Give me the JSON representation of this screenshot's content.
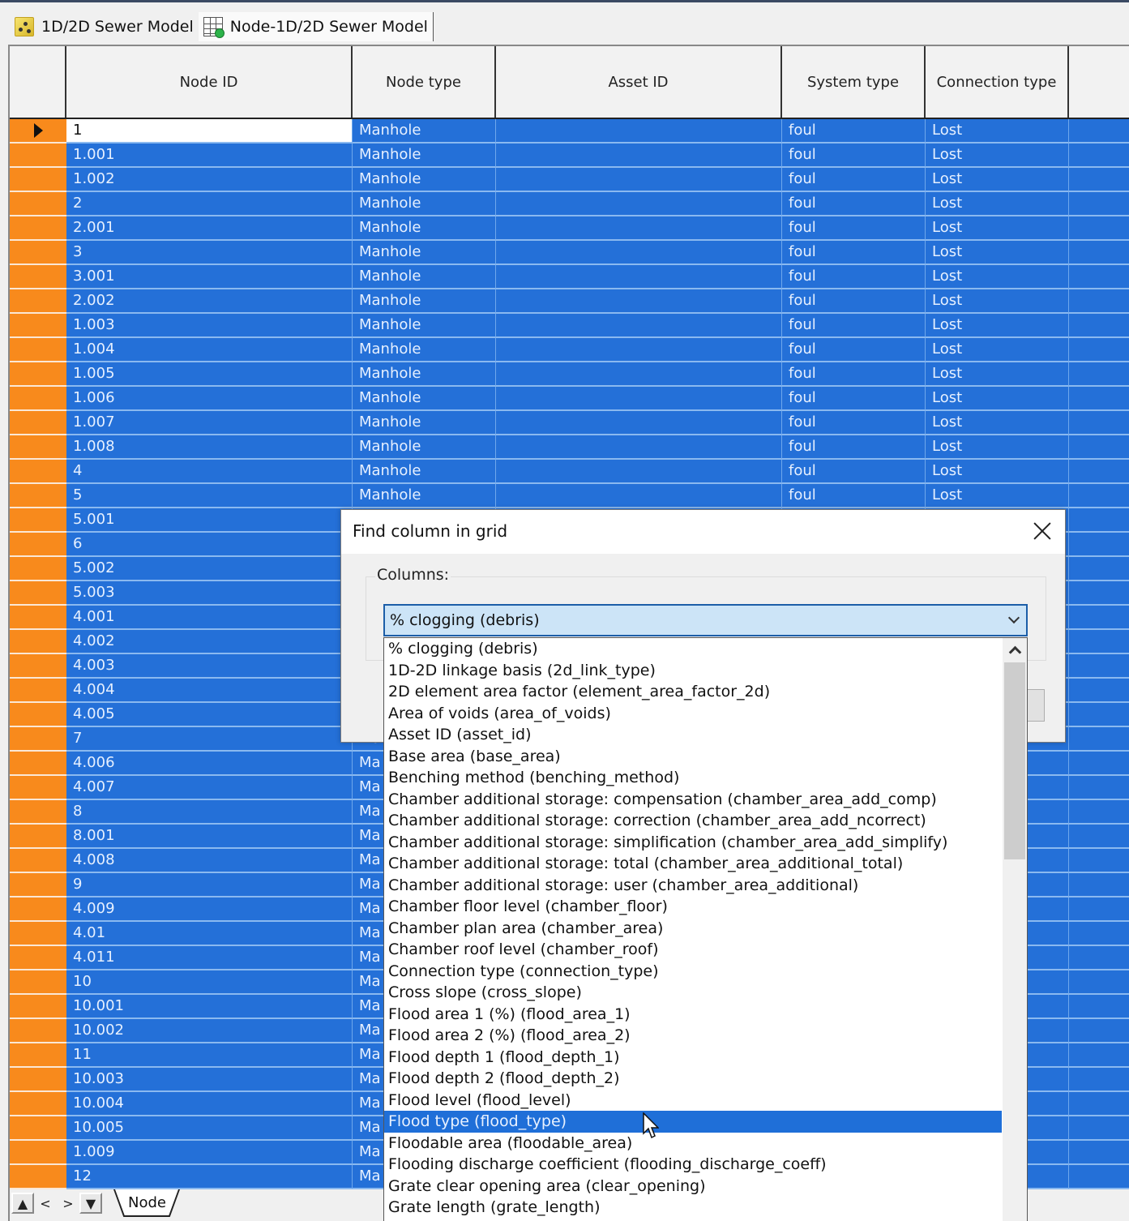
{
  "tabs": [
    {
      "label": "1D/2D Sewer Model",
      "icon": "network-model-icon",
      "active": false
    },
    {
      "label": "Node-1D/2D Sewer Model",
      "icon": "grid-table-icon",
      "active": true
    }
  ],
  "grid": {
    "columns": [
      "",
      "Node ID",
      "Node type",
      "Asset ID",
      "System type",
      "Connection type",
      ""
    ],
    "current_row_index": 0,
    "rows": [
      {
        "id": "1",
        "type": "Manhole",
        "asset": "",
        "system": "foul",
        "conn": "Lost"
      },
      {
        "id": "1.001",
        "type": "Manhole",
        "asset": "",
        "system": "foul",
        "conn": "Lost"
      },
      {
        "id": "1.002",
        "type": "Manhole",
        "asset": "",
        "system": "foul",
        "conn": "Lost"
      },
      {
        "id": "2",
        "type": "Manhole",
        "asset": "",
        "system": "foul",
        "conn": "Lost"
      },
      {
        "id": "2.001",
        "type": "Manhole",
        "asset": "",
        "system": "foul",
        "conn": "Lost"
      },
      {
        "id": "3",
        "type": "Manhole",
        "asset": "",
        "system": "foul",
        "conn": "Lost"
      },
      {
        "id": "3.001",
        "type": "Manhole",
        "asset": "",
        "system": "foul",
        "conn": "Lost"
      },
      {
        "id": "2.002",
        "type": "Manhole",
        "asset": "",
        "system": "foul",
        "conn": "Lost"
      },
      {
        "id": "1.003",
        "type": "Manhole",
        "asset": "",
        "system": "foul",
        "conn": "Lost"
      },
      {
        "id": "1.004",
        "type": "Manhole",
        "asset": "",
        "system": "foul",
        "conn": "Lost"
      },
      {
        "id": "1.005",
        "type": "Manhole",
        "asset": "",
        "system": "foul",
        "conn": "Lost"
      },
      {
        "id": "1.006",
        "type": "Manhole",
        "asset": "",
        "system": "foul",
        "conn": "Lost"
      },
      {
        "id": "1.007",
        "type": "Manhole",
        "asset": "",
        "system": "foul",
        "conn": "Lost"
      },
      {
        "id": "1.008",
        "type": "Manhole",
        "asset": "",
        "system": "foul",
        "conn": "Lost"
      },
      {
        "id": "4",
        "type": "Manhole",
        "asset": "",
        "system": "foul",
        "conn": "Lost"
      },
      {
        "id": "5",
        "type": "Manhole",
        "asset": "",
        "system": "foul",
        "conn": "Lost"
      },
      {
        "id": "5.001",
        "type": "",
        "asset": "",
        "system": "",
        "conn": ""
      },
      {
        "id": "6",
        "type": "",
        "asset": "",
        "system": "",
        "conn": ""
      },
      {
        "id": "5.002",
        "type": "",
        "asset": "",
        "system": "",
        "conn": ""
      },
      {
        "id": "5.003",
        "type": "",
        "asset": "",
        "system": "",
        "conn": ""
      },
      {
        "id": "4.001",
        "type": "",
        "asset": "",
        "system": "",
        "conn": ""
      },
      {
        "id": "4.002",
        "type": "",
        "asset": "",
        "system": "",
        "conn": ""
      },
      {
        "id": "4.003",
        "type": "",
        "asset": "",
        "system": "",
        "conn": ""
      },
      {
        "id": "4.004",
        "type": "",
        "asset": "",
        "system": "",
        "conn": ""
      },
      {
        "id": "4.005",
        "type": "",
        "asset": "",
        "system": "",
        "conn": ""
      },
      {
        "id": "7",
        "type": "Ma",
        "asset": "",
        "system": "",
        "conn": ""
      },
      {
        "id": "4.006",
        "type": "Ma",
        "asset": "",
        "system": "",
        "conn": ""
      },
      {
        "id": "4.007",
        "type": "Ma",
        "asset": "",
        "system": "",
        "conn": ""
      },
      {
        "id": "8",
        "type": "Ma",
        "asset": "",
        "system": "",
        "conn": ""
      },
      {
        "id": "8.001",
        "type": "Ma",
        "asset": "",
        "system": "",
        "conn": ""
      },
      {
        "id": "4.008",
        "type": "Ma",
        "asset": "",
        "system": "",
        "conn": ""
      },
      {
        "id": "9",
        "type": "Ma",
        "asset": "",
        "system": "",
        "conn": ""
      },
      {
        "id": "4.009",
        "type": "Ma",
        "asset": "",
        "system": "",
        "conn": ""
      },
      {
        "id": "4.01",
        "type": "Ma",
        "asset": "",
        "system": "",
        "conn": ""
      },
      {
        "id": "4.011",
        "type": "Ma",
        "asset": "",
        "system": "",
        "conn": ""
      },
      {
        "id": "10",
        "type": "Ma",
        "asset": "",
        "system": "",
        "conn": ""
      },
      {
        "id": "10.001",
        "type": "Ma",
        "asset": "",
        "system": "",
        "conn": ""
      },
      {
        "id": "10.002",
        "type": "Ma",
        "asset": "",
        "system": "",
        "conn": ""
      },
      {
        "id": "11",
        "type": "Ma",
        "asset": "",
        "system": "",
        "conn": ""
      },
      {
        "id": "10.003",
        "type": "Ma",
        "asset": "",
        "system": "",
        "conn": ""
      },
      {
        "id": "10.004",
        "type": "Ma",
        "asset": "",
        "system": "",
        "conn": ""
      },
      {
        "id": "10.005",
        "type": "Ma",
        "asset": "",
        "system": "",
        "conn": ""
      },
      {
        "id": "1.009",
        "type": "Ma",
        "asset": "",
        "system": "",
        "conn": ""
      },
      {
        "id": "12",
        "type": "Ma",
        "asset": "",
        "system": "",
        "conn": ""
      }
    ]
  },
  "footer": {
    "nav": [
      "▲",
      "<",
      ">",
      "▼"
    ],
    "sheet_tab": "Node"
  },
  "dialog": {
    "title": "Find column in grid",
    "group_label": "Columns:",
    "combo_value": "% clogging (debris)",
    "selected_index": 22,
    "options": [
      "% clogging (debris)",
      "1D-2D linkage basis (2d_link_type)",
      "2D element area factor (element_area_factor_2d)",
      "Area of voids (area_of_voids)",
      "Asset ID (asset_id)",
      "Base area (base_area)",
      "Benching method (benching_method)",
      "Chamber additional storage: compensation (chamber_area_add_comp)",
      "Chamber additional storage: correction (chamber_area_add_ncorrect)",
      "Chamber additional storage: simplification (chamber_area_add_simplify)",
      "Chamber additional storage: total (chamber_area_additional_total)",
      "Chamber additional storage: user (chamber_area_additional)",
      "Chamber floor level (chamber_floor)",
      "Chamber plan area (chamber_area)",
      "Chamber roof level (chamber_roof)",
      "Connection type (connection_type)",
      "Cross slope (cross_slope)",
      "Flood area 1 (%) (flood_area_1)",
      "Flood area 2 (%) (flood_area_2)",
      "Flood depth 1 (flood_depth_1)",
      "Flood depth 2 (flood_depth_2)",
      "Flood level (flood_level)",
      "Flood type (flood_type)",
      "Floodable area (floodable_area)",
      "Flooding discharge coefficient (flooding_discharge_coeff)",
      "Grate clear opening area (clear_opening)",
      "Grate length (grate_length)"
    ]
  },
  "colors": {
    "selection_blue": "#2470d8",
    "row_header_orange": "#f88a1c",
    "combo_focus": "#cce4f7"
  }
}
